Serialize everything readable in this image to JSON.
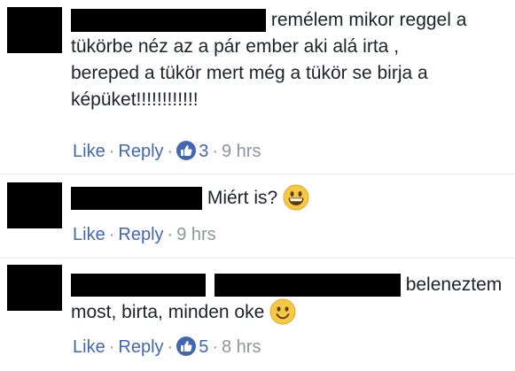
{
  "comments": [
    {
      "text_lines": [
        "remélem mikor reggel a",
        "tükörbe néz az a pár ember aki alá irta ,",
        "bereped a tükör mert még a tükör se birja a",
        "képüket!!!!!!!!!!!!"
      ],
      "actions": {
        "like": "Like",
        "reply": "Reply"
      },
      "reaction_count": "3",
      "time": "9 hrs"
    },
    {
      "text": "Miért is?",
      "emoji": "grinning-face",
      "actions": {
        "like": "Like",
        "reply": "Reply"
      },
      "time": "9 hrs"
    },
    {
      "text_lines": [
        "beleneztem",
        "most, birta, minden oke"
      ],
      "emoji": "smiling-face",
      "actions": {
        "like": "Like",
        "reply": "Reply"
      },
      "reaction_count": "5",
      "time": "8 hrs"
    }
  ],
  "colors": {
    "link": "#4267b2",
    "meta": "#90949c",
    "text": "#1d2129",
    "redaction": "#000000"
  }
}
